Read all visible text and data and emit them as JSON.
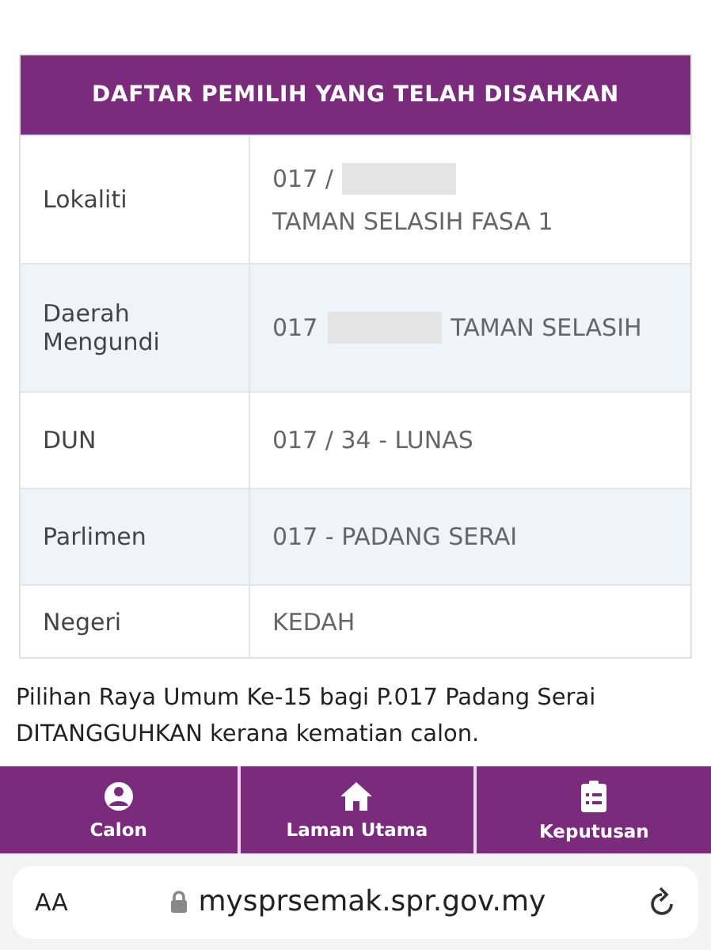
{
  "table": {
    "title": "DAFTAR PEMILIH YANG TELAH DISAHKAN",
    "rows": [
      {
        "label": "Lokaliti",
        "value": [
          {
            "kind": "text",
            "text": "017 /"
          },
          {
            "kind": "redacted"
          },
          {
            "kind": "break"
          },
          {
            "kind": "text",
            "text": "TAMAN SELASIH FASA 1"
          }
        ]
      },
      {
        "label": "Daerah Mengundi",
        "value": [
          {
            "kind": "text",
            "text": "017"
          },
          {
            "kind": "redacted"
          },
          {
            "kind": "text",
            "text": "TAMAN SELASIH"
          }
        ]
      },
      {
        "label": "DUN",
        "value": [
          {
            "kind": "text",
            "text": "017 / 34 - LUNAS"
          }
        ]
      },
      {
        "label": "Parlimen",
        "value": [
          {
            "kind": "text",
            "text": "017 - PADANG SERAI"
          }
        ]
      },
      {
        "label": "Negeri",
        "value": [
          {
            "kind": "text",
            "text": "KEDAH"
          }
        ]
      }
    ]
  },
  "notice": "Pilihan Raya Umum Ke-15 bagi P.017 Padang Serai DITANGGUHKAN kerana kematian calon.",
  "nav": [
    {
      "kind": "person",
      "label": "Calon"
    },
    {
      "kind": "home",
      "label": "Laman Utama"
    },
    {
      "kind": "clipboard",
      "label": "Keputusan"
    }
  ],
  "browser": {
    "text_size": "AA",
    "url": "mysprsemak.spr.gov.my"
  }
}
